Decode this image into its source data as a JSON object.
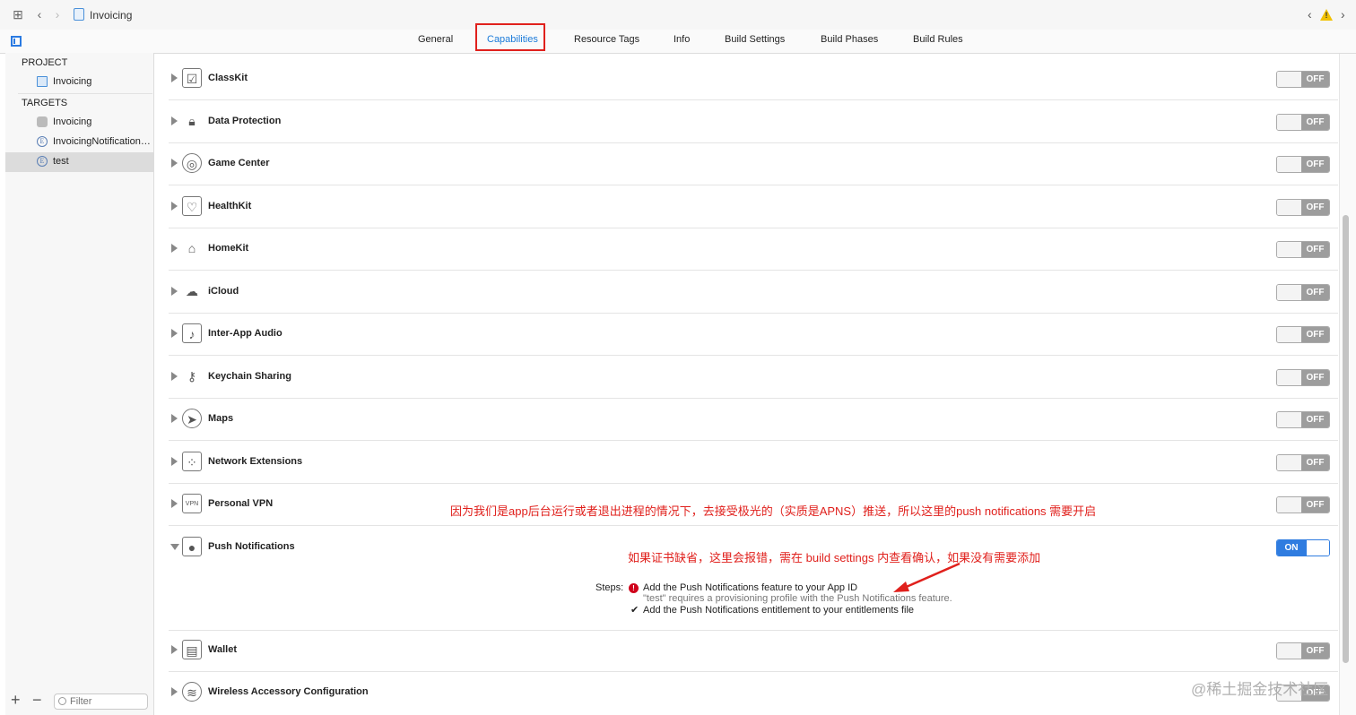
{
  "breadcrumb": {
    "file_label": "Invoicing"
  },
  "tabs": [
    {
      "label": "General"
    },
    {
      "label": "Capabilities"
    },
    {
      "label": "Resource Tags"
    },
    {
      "label": "Info"
    },
    {
      "label": "Build Settings"
    },
    {
      "label": "Build Phases"
    },
    {
      "label": "Build Rules"
    }
  ],
  "sidebar": {
    "project_header": "PROJECT",
    "project_item": "Invoicing",
    "targets_header": "TARGETS",
    "targets": [
      {
        "label": "Invoicing"
      },
      {
        "label": "InvoicingNotificationService"
      },
      {
        "label": "test"
      }
    ],
    "filter_placeholder": "Filter",
    "plus": "+",
    "minus": "−"
  },
  "capabilities": [
    {
      "name": "ClassKit",
      "state": "OFF",
      "icon": "classkit-icon"
    },
    {
      "name": "Data Protection",
      "state": "OFF",
      "icon": "lock-icon"
    },
    {
      "name": "Game Center",
      "state": "OFF",
      "icon": "game-center-icon"
    },
    {
      "name": "HealthKit",
      "state": "OFF",
      "icon": "heart-icon"
    },
    {
      "name": "HomeKit",
      "state": "OFF",
      "icon": "home-icon"
    },
    {
      "name": "iCloud",
      "state": "OFF",
      "icon": "cloud-icon"
    },
    {
      "name": "Inter-App Audio",
      "state": "OFF",
      "icon": "audio-icon"
    },
    {
      "name": "Keychain Sharing",
      "state": "OFF",
      "icon": "key-icon"
    },
    {
      "name": "Maps",
      "state": "OFF",
      "icon": "maps-icon"
    },
    {
      "name": "Network Extensions",
      "state": "OFF",
      "icon": "network-icon"
    },
    {
      "name": "Personal VPN",
      "state": "OFF",
      "icon": "vpn-icon"
    },
    {
      "name": "Push Notifications",
      "state": "ON",
      "icon": "push-icon"
    },
    {
      "name": "Wallet",
      "state": "OFF",
      "icon": "wallet-icon"
    },
    {
      "name": "Wireless Accessory Configuration",
      "state": "OFF",
      "icon": "wireless-icon"
    }
  ],
  "vpn_icon_text": "VPN",
  "push_steps": {
    "label": "Steps:",
    "error_mark": "!",
    "step1": "Add the Push Notifications feature to your App ID",
    "step1_detail": "\"test\" requires a provisioning profile with the Push Notifications feature.",
    "check_mark": "✔",
    "step2": "Add the Push Notifications entitlement to your entitlements file"
  },
  "annotations": {
    "note1": "因为我们是app后台运行或者退出进程的情况下，去接受极光的（实质是APNS）推送，所以这里的push notifications 需要开启",
    "note2": "如果证书缺省，这里会报错，需在 build settings 内查看确认，如果没有需要添加"
  },
  "watermark": "@稀土掘金技术社区",
  "colors": {
    "accent": "#2f7ce0",
    "annotation_red": "#e0201c",
    "toggle_off": "#9d9d9d"
  }
}
